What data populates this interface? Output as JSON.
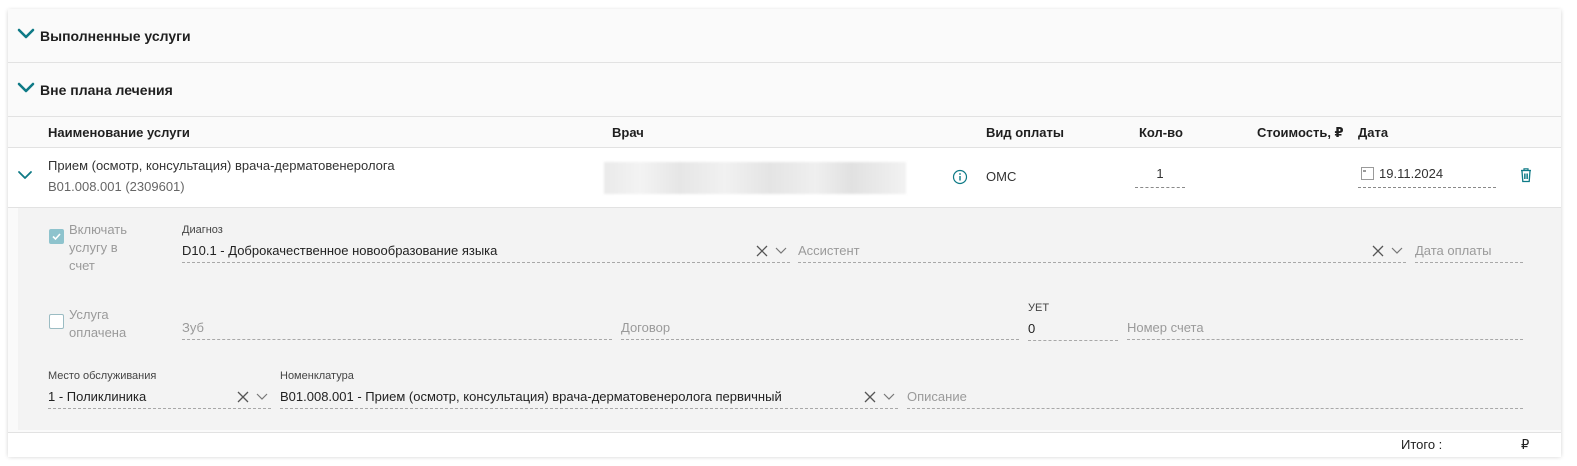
{
  "sections": {
    "completed_title": "Выполненные услуги",
    "outside_plan_title": "Вне плана лечения"
  },
  "table": {
    "headers": {
      "service_name": "Наименование услуги",
      "doctor": "Врач",
      "payment_type": "Вид оплаты",
      "quantity": "Кол-во",
      "cost": "Стоимость, ₽",
      "date": "Дата"
    },
    "rows": [
      {
        "service_name": "Прием (осмотр, консультация) врача-дерматовенеролога",
        "service_code": "B01.008.001 (2309601)",
        "payment_type": "ОМС",
        "quantity": "1",
        "date": "19.11.2024"
      }
    ]
  },
  "details": {
    "include_in_bill": {
      "label_line1": "Включать",
      "label_line2": "услугу в счет",
      "checked": true
    },
    "service_paid": {
      "label_line1": "Услуга",
      "label_line2": "оплачена",
      "checked": false
    },
    "diagnosis": {
      "label": "Диагноз",
      "value": "D10.1 - Доброкачественное новообразование языка"
    },
    "assistant": {
      "placeholder": "Ассистент"
    },
    "payment_date": {
      "placeholder": "Дата оплаты"
    },
    "tooth": {
      "placeholder": "Зуб"
    },
    "contract": {
      "placeholder": "Договор"
    },
    "uet": {
      "label": "УЕТ",
      "value": "0"
    },
    "invoice_number": {
      "placeholder": "Номер счета"
    },
    "service_place": {
      "label": "Место обслуживания",
      "value": "1 - Поликлиника"
    },
    "nomenclature": {
      "label": "Номенклатура",
      "value": "B01.008.001 - Прием (осмотр, консультация) врача-дерматовенеролога первичный"
    },
    "description": {
      "placeholder": "Описание"
    }
  },
  "footer": {
    "total_label": "Итого :",
    "currency": "₽"
  },
  "colors": {
    "accent": "#0e7a86",
    "checkbox_checked": "#8ec3cd"
  }
}
